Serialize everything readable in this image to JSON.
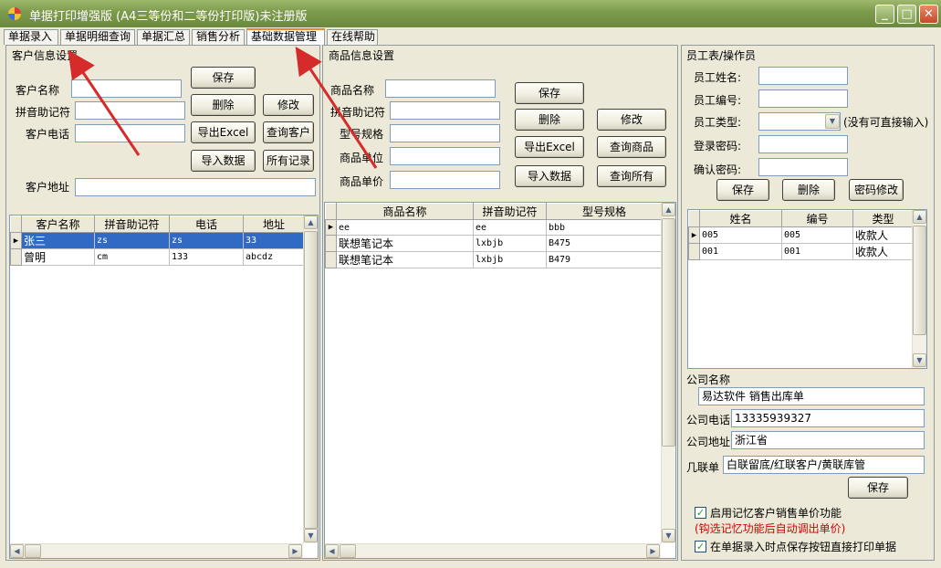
{
  "window": {
    "title": "单据打印增强版 (A4三等份和二等份打印版)未注册版",
    "minimize": "_",
    "maximize": "□",
    "close": "✕"
  },
  "tabs": [
    "单据录入",
    "单据明细查询",
    "单据汇总",
    "销售分析",
    "基础数据管理",
    "在线帮助"
  ],
  "customer": {
    "group_title": "客户信息设置",
    "name_label": "客户名称",
    "pinyin_label": "拼音助记符",
    "phone_label": "客户电话",
    "address_label": "客户地址",
    "name_value": "",
    "pinyin_value": "",
    "phone_value": "",
    "address_value": "",
    "buttons": {
      "save": "保存",
      "delete": "删除",
      "modify": "修改",
      "export": "导出Excel",
      "query": "查询客户",
      "import": "导入数据",
      "all": "所有记录"
    },
    "grid": {
      "headers": [
        "客户名称",
        "拼音助记符",
        "电话",
        "地址"
      ],
      "rows": [
        {
          "name": "张三",
          "pinyin": "zs",
          "phone": "zs",
          "address": "33"
        },
        {
          "name": "曾明",
          "pinyin": "cm",
          "phone": "133",
          "address": "abcdz"
        }
      ]
    }
  },
  "product": {
    "group_title": "商品信息设置",
    "name_label": "商品名称",
    "pinyin_label": "拼音助记符",
    "model_label": "型号规格",
    "unit_label": "商品单位",
    "price_label": "商品单价",
    "buttons": {
      "save": "保存",
      "delete": "删除",
      "modify": "修改",
      "export": "导出Excel",
      "query": "查询商品",
      "import": "导入数据",
      "all": "查询所有"
    },
    "grid": {
      "headers": [
        "商品名称",
        "拼音助记符",
        "型号规格"
      ],
      "rows": [
        {
          "name": "ee",
          "pinyin": "ee",
          "model": "bbb"
        },
        {
          "name": "联想笔记本",
          "pinyin": "lxbjb",
          "model": "B475"
        },
        {
          "name": "联想笔记本",
          "pinyin": "lxbjb",
          "model": "B479"
        }
      ]
    }
  },
  "staff": {
    "group_title": "员工表/操作员",
    "name_label": "员工姓名:",
    "id_label": "员工编号:",
    "type_label": "员工类型:",
    "type_hint": "(没有可直接输入)",
    "pwd_label": "登录密码:",
    "confirm_label": "确认密码:",
    "buttons": {
      "save": "保存",
      "delete": "删除",
      "change_pwd": "密码修改"
    },
    "grid": {
      "headers": [
        "姓名",
        "编号",
        "类型"
      ],
      "rows": [
        {
          "name": "005",
          "id": "005",
          "type": "收款人"
        },
        {
          "name": "001",
          "id": "001",
          "type": "收款人"
        }
      ]
    }
  },
  "company": {
    "name_label": "公司名称",
    "name_value": "易达软件 销售出库单",
    "phone_label": "公司电话",
    "phone_value": "13335939327",
    "address_label": "公司地址",
    "address_value": "浙江省",
    "copies_label": "几联单",
    "copies_value": "白联留底/红联客户/黄联库管",
    "save": "保存",
    "opt1": "启用记忆客户销售单价功能",
    "opt1_note": "(钩选记忆功能后自动调出单价)",
    "opt2": "在单据录入时点保存按钮直接打印单据",
    "opt1_checked": true,
    "opt2_checked": true
  },
  "colors": {
    "titlebar": "#7c9a4b",
    "selection": "#316ac5",
    "active_tab_accent": "#e68b2c",
    "annotation_arrow": "#d62b2b"
  }
}
